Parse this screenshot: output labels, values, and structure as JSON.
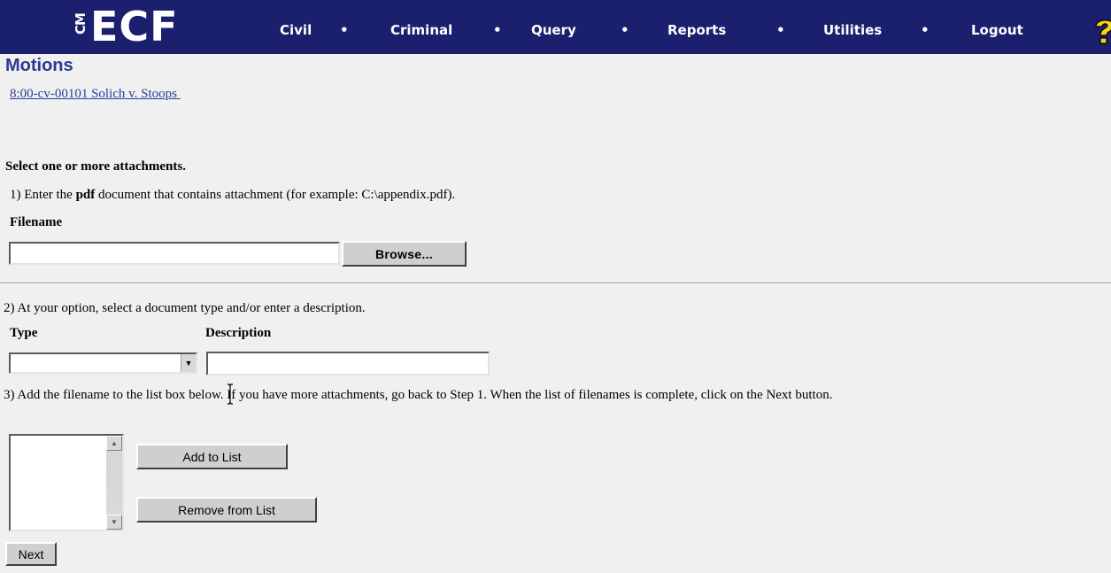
{
  "app": {
    "logo_prefix": "CM",
    "logo_text": "ECF",
    "nav": [
      "Civil",
      "Criminal",
      "Query",
      "Reports",
      "Utilities",
      "Logout"
    ],
    "separator": "•"
  },
  "page": {
    "title": "Motions",
    "case_link": "8:00-cv-00101 Solich v. Stoops "
  },
  "form": {
    "heading": "Select one or more attachments.",
    "step1_pre": "1) Enter the ",
    "step1_bold": "pdf",
    "step1_post": " document that contains attachment (for example: C:\\appendix.pdf).",
    "filename_label": "Filename",
    "filename_value": "",
    "browse_label": "Browse...",
    "step2": "2) At your option, select a document type and/or enter a description.",
    "type_label": "Type",
    "type_value": "",
    "description_label": "Description",
    "description_value": "",
    "step3": "3) Add the filename to the list box below. If you have more attachments, go back to Step 1. When the list of filenames is complete, click on the Next button.",
    "add_label": "Add to List",
    "remove_label": "Remove from List",
    "next_label": "Next"
  }
}
